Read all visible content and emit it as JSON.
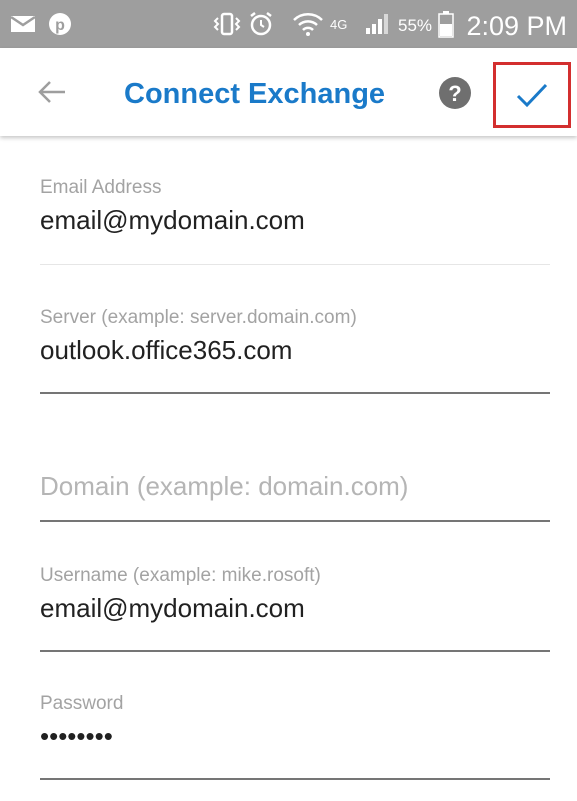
{
  "status_bar": {
    "battery_percent": "55%",
    "network": "4G",
    "time": "2:09 PM",
    "icons": [
      "mail-icon",
      "pinterest-icon",
      "vibrate-icon",
      "alarm-icon",
      "wifi-icon",
      "lte-icon",
      "signal-icon",
      "battery-icon"
    ]
  },
  "app_bar": {
    "title": "Connect Exchange",
    "help_glyph": "?",
    "accent_color": "#1a7ac9",
    "highlight_color": "#d32f2f"
  },
  "form": {
    "email": {
      "label": "Email Address",
      "value": "email@mydomain.com"
    },
    "server": {
      "label": "Server (example: server.domain.com)",
      "value": "outlook.office365.com"
    },
    "domain": {
      "label": "",
      "value": "",
      "placeholder": "Domain (example: domain.com)"
    },
    "username": {
      "label": "Username (example: mike.rosoft)",
      "value": "email@mydomain.com"
    },
    "password": {
      "label": "Password",
      "value": "••••••••"
    }
  }
}
